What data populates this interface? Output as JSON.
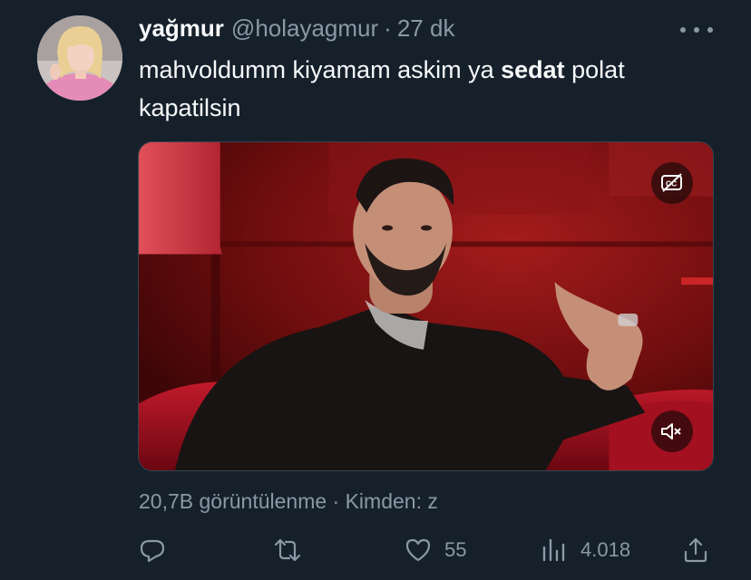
{
  "tweet": {
    "display_name": "yağmur",
    "handle": "@holayagmur",
    "separator": "·",
    "time": "27 dk",
    "text_before": "mahvoldumm kiyamam askim ya ",
    "text_bold": "sedat",
    "text_after": " polat kapatilsin",
    "meta": "20,7B görüntülenme · Kimden: z"
  },
  "actions": {
    "reply_icon": "reply-icon",
    "retweet_icon": "retweet-icon",
    "like_icon": "heart-icon",
    "like_count": "55",
    "views_icon": "analytics-icon",
    "views_count": "4.018",
    "share_icon": "share-icon"
  },
  "media": {
    "captions_icon": "closed-captions-off-icon",
    "mute_icon": "speaker-muted-icon"
  },
  "colors": {
    "background": "#15202b",
    "primary_text": "#f7f9f9",
    "secondary_text": "#8b98a5",
    "border": "#38444d"
  }
}
